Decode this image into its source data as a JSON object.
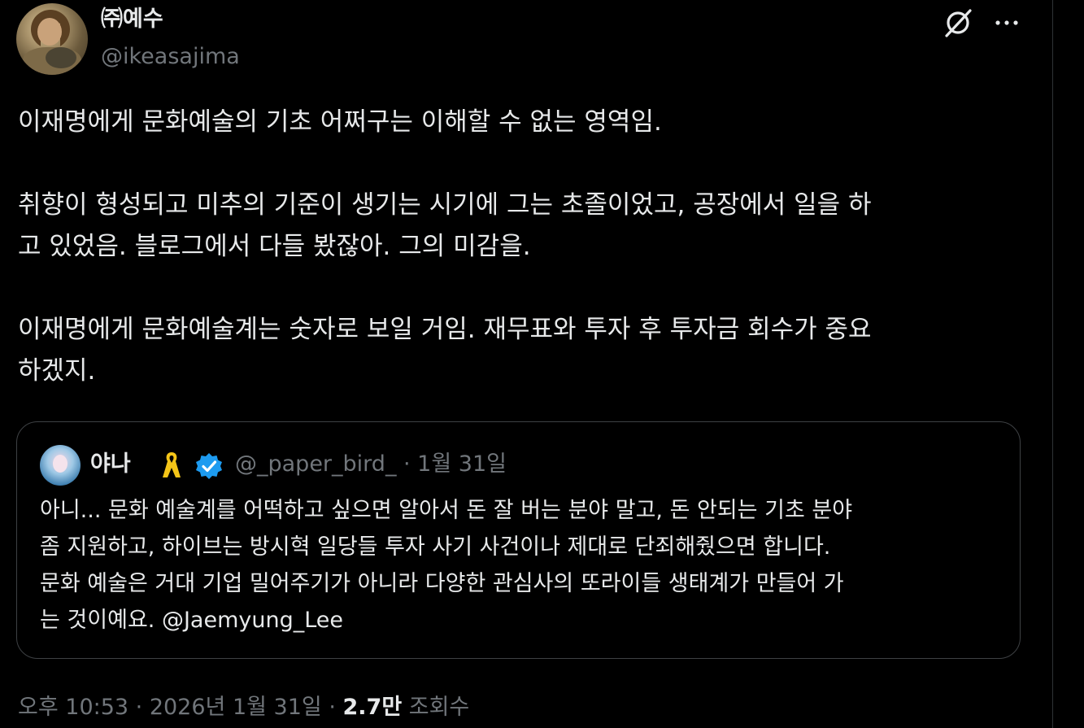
{
  "author": {
    "display_name": "㈜예수",
    "handle": "@ikeasajima"
  },
  "tweet": {
    "text": "이재명에게 문화예술의 기초 어쩌구는 이해할 수 없는 영역임.\n\n취향이 형성되고 미추의 기준이 생기는 시기에 그는 초졸이었고, 공장에서 일을 하\n고 있었음. 블로그에서 다들 봤잖아. 그의 미감을.\n\n이재명에게 문화예술계는 숫자로 보일 거임. 재무표와 투자 후 투자금 회수가 중요\n하겠지."
  },
  "quote": {
    "display_name": "야나",
    "handle_and_date": "@_paper_bird_ · 1월 31일",
    "text": "아니... 문화 예술계를 어떡하고 싶으면 알아서 돈 잘 버는 분야 말고, 돈 안되는 기초 분야\n좀 지원하고, 하이브는 방시혁 일당들 투자 사기 사건이나 제대로 단죄해줬으면 합니다.\n문화 예술은 거대 기업 밀어주기가 아니라 다양한 관심사의 또라이들 생태계가 만들어 가\n는 것이예요. @Jaemyung_Lee"
  },
  "meta": {
    "timestamp": "오후 10:53 · 2026년 1월 31일 · ",
    "views_count": "2.7만",
    "views_label": " 조회수"
  },
  "icons": {
    "grok": "grok-icon",
    "more": "more-icon",
    "ribbon": "yellow-ribbon-icon",
    "verified": "verified-badge-icon"
  },
  "colors": {
    "background": "#000000",
    "text": "#e7e9ea",
    "secondary_text": "#71767b",
    "verified_blue": "#1d9bf0",
    "ribbon_yellow": "#f5c518",
    "border": "#3e4144"
  }
}
